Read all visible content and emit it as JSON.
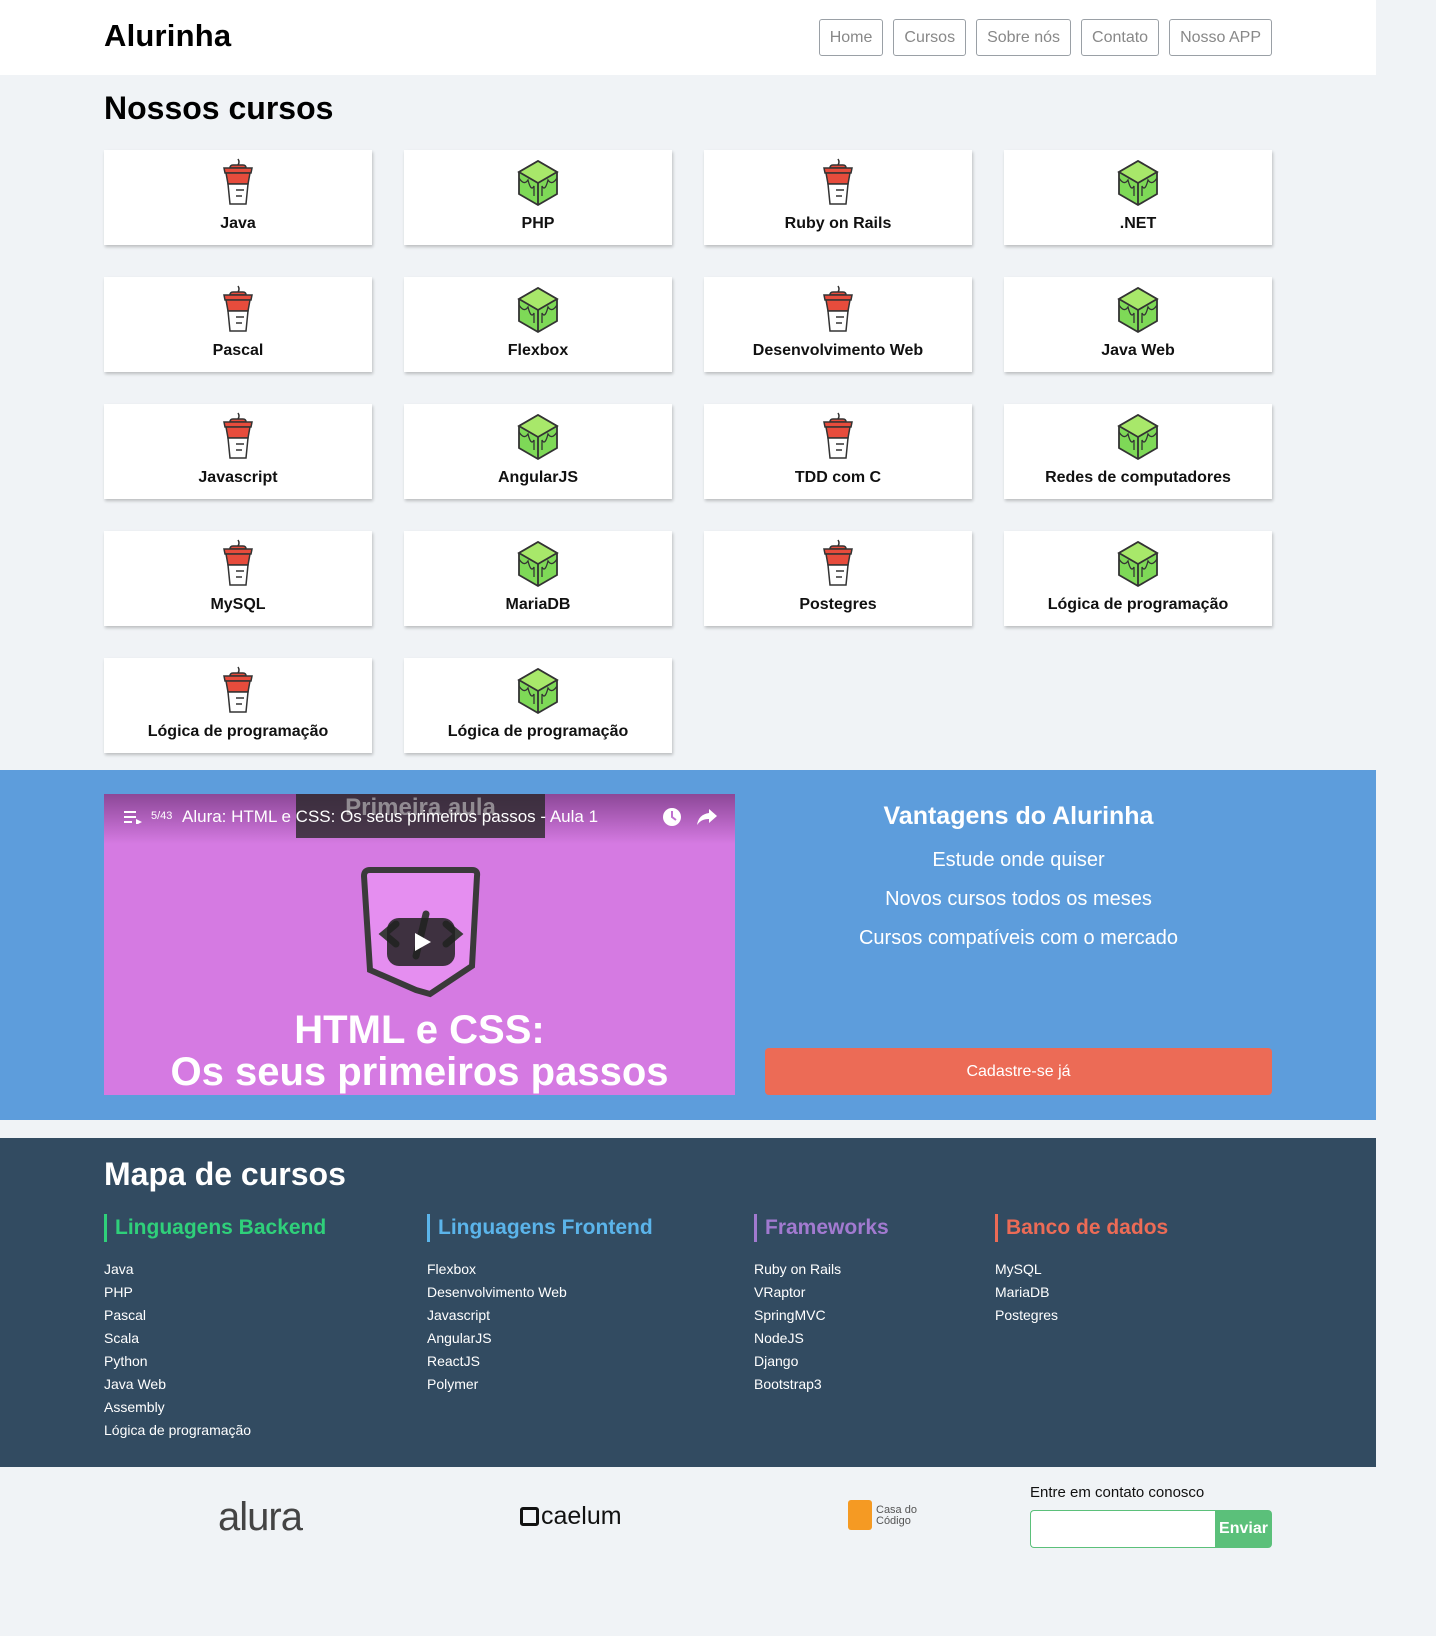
{
  "header": {
    "logo": "Alurinha",
    "nav": [
      "Home",
      "Cursos",
      "Sobre nós",
      "Contato",
      "Nosso APP"
    ]
  },
  "courses": {
    "title": "Nossos cursos",
    "items": [
      {
        "label": "Java",
        "icon": "cup-icon"
      },
      {
        "label": "PHP",
        "icon": "cube-icon"
      },
      {
        "label": "Ruby on Rails",
        "icon": "cup-icon"
      },
      {
        "label": ".NET",
        "icon": "cube-icon"
      },
      {
        "label": "Pascal",
        "icon": "cup-icon"
      },
      {
        "label": "Flexbox",
        "icon": "cube-icon"
      },
      {
        "label": "Desenvolvimento Web",
        "icon": "cup-icon"
      },
      {
        "label": "Java Web",
        "icon": "cube-icon"
      },
      {
        "label": "Javascript",
        "icon": "cup-icon"
      },
      {
        "label": "AngularJS",
        "icon": "cube-icon"
      },
      {
        "label": "TDD com C",
        "icon": "cup-icon"
      },
      {
        "label": "Redes de computadores",
        "icon": "cube-icon"
      },
      {
        "label": "MySQL",
        "icon": "cup-icon"
      },
      {
        "label": "MariaDB",
        "icon": "cube-icon"
      },
      {
        "label": "Postegres",
        "icon": "cup-icon"
      },
      {
        "label": "Lógica de programação",
        "icon": "cube-icon"
      },
      {
        "label": "Lógica de programação",
        "icon": "cup-icon"
      },
      {
        "label": "Lógica de programação",
        "icon": "cube-icon"
      }
    ]
  },
  "video": {
    "playlist_position": "5/43",
    "title": "Alura: HTML e CSS: Os seus primeiros passos - Aula 1",
    "overlay": "Primeira aula",
    "headline_line1": "HTML e CSS:",
    "headline_line2": "Os seus primeiros passos"
  },
  "advantages": {
    "title": "Vantagens do Alurinha",
    "items": [
      "Estude onde quiser",
      "Novos cursos todos os meses",
      "Cursos compatíveis com o mercado"
    ],
    "cta": "Cadastre-se já"
  },
  "map": {
    "title": "Mapa de cursos",
    "columns": [
      {
        "heading": "Linguagens Backend",
        "color": "#2fd07a",
        "items": [
          "Java",
          "PHP",
          "Pascal",
          "Scala",
          "Python",
          "Java Web",
          "Assembly",
          "Lógica de programação"
        ]
      },
      {
        "heading": "Linguagens Frontend",
        "color": "#5bb4ea",
        "items": [
          "Flexbox",
          "Desenvolvimento Web",
          "Javascript",
          "AngularJS",
          "ReactJS",
          "Polymer"
        ]
      },
      {
        "heading": "Frameworks",
        "color": "#a27ad0",
        "items": [
          "Ruby on Rails",
          "VRaptor",
          "SpringMVC",
          "NodeJS",
          "Django",
          "Bootstrap3"
        ]
      },
      {
        "heading": "Banco de dados",
        "color": "#ec6b56",
        "items": [
          "MySQL",
          "MariaDB",
          "Postegres"
        ]
      }
    ]
  },
  "footer": {
    "alura": "alura",
    "caelum": "caelum",
    "casa_line1": "Casa do",
    "casa_line2": "Código",
    "contact_label": "Entre em contato conosco",
    "contact_placeholder": "",
    "send": "Enviar"
  },
  "colors": {
    "accent_blue": "#5d9ddc",
    "cta": "#ec6b56",
    "map_bg": "#324b61",
    "send": "#5bc07a"
  }
}
